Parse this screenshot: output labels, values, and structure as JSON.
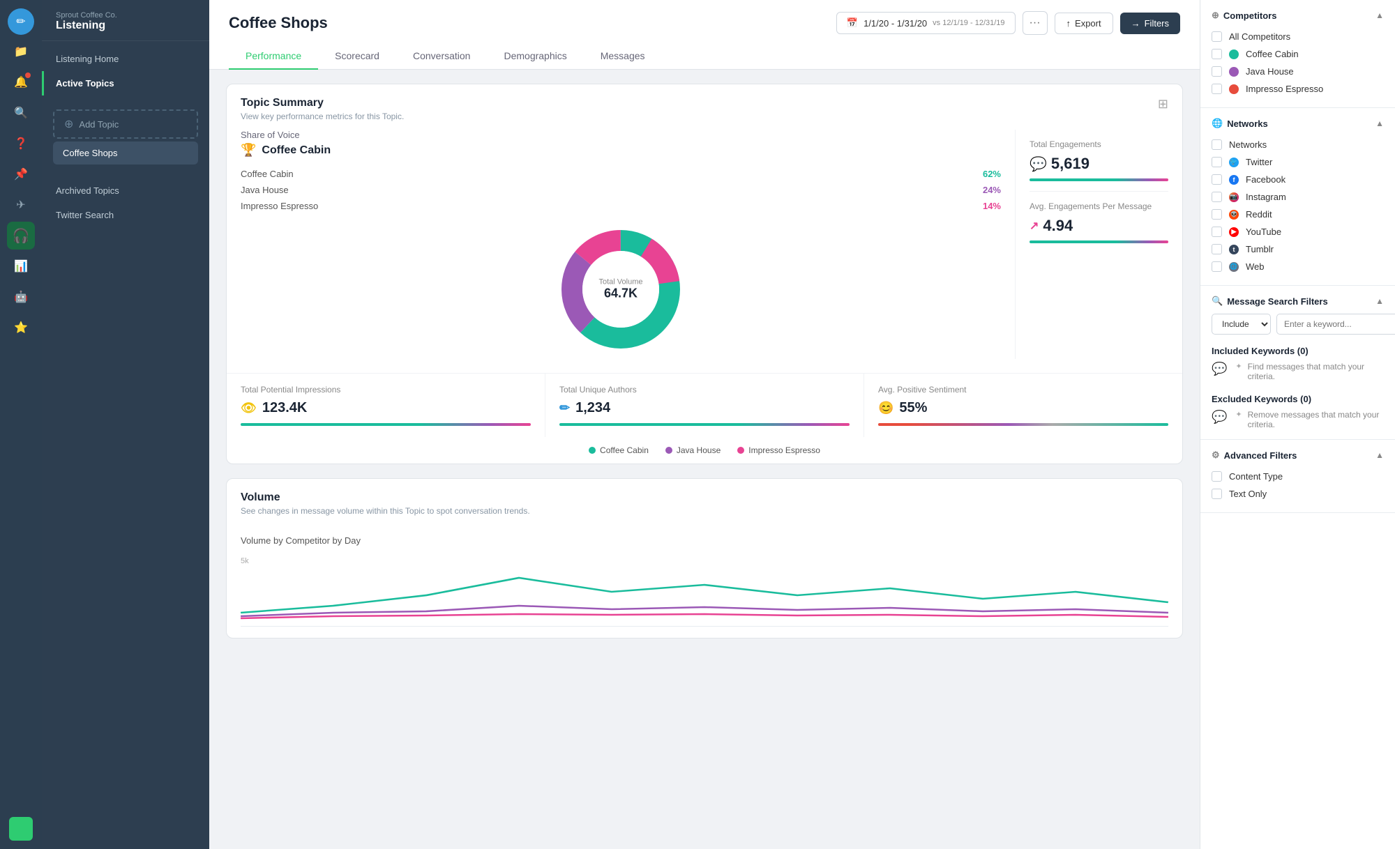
{
  "brand": {
    "company": "Sprout Coffee Co.",
    "product": "Listening"
  },
  "sidebar": {
    "nav_items": [
      {
        "id": "listening-home",
        "label": "Listening Home",
        "active": false
      },
      {
        "id": "active-topics",
        "label": "Active Topics",
        "active": true
      }
    ],
    "add_topic_label": "Add Topic",
    "topics": [
      {
        "id": "coffee-shops",
        "label": "Coffee Shops",
        "active": true
      }
    ],
    "bottom_nav": [
      {
        "id": "archived-topics",
        "label": "Archived Topics"
      },
      {
        "id": "twitter-search",
        "label": "Twitter Search"
      }
    ]
  },
  "header": {
    "page_title": "Coffee Shops",
    "date_range": "1/1/20 - 1/31/20",
    "date_compare": "vs 12/1/19 - 12/31/19",
    "export_label": "Export",
    "filters_label": "Filters"
  },
  "tabs": [
    {
      "id": "performance",
      "label": "Performance",
      "active": true
    },
    {
      "id": "scorecard",
      "label": "Scorecard",
      "active": false
    },
    {
      "id": "conversation",
      "label": "Conversation",
      "active": false
    },
    {
      "id": "demographics",
      "label": "Demographics",
      "active": false
    },
    {
      "id": "messages",
      "label": "Messages",
      "active": false
    }
  ],
  "topic_summary": {
    "title": "Topic Summary",
    "subtitle": "View key performance metrics for this Topic.",
    "share_of_voice_label": "Share of Voice",
    "winner": "Coffee Cabin",
    "competitors": [
      {
        "name": "Coffee Cabin",
        "pct": "62%",
        "color": "teal",
        "donut_pct": 62
      },
      {
        "name": "Java House",
        "pct": "24%",
        "color": "purple",
        "donut_pct": 24
      },
      {
        "name": "Impresso Espresso",
        "pct": "14%",
        "color": "pink",
        "donut_pct": 14
      }
    ],
    "donut_center_label": "Total Volume",
    "donut_center_value": "64.7K",
    "total_engagements_label": "Total Engagements",
    "total_engagements_value": "5,619",
    "avg_engagements_label": "Avg. Engagements Per Message",
    "avg_engagements_value": "4.94",
    "total_impressions_label": "Total Potential Impressions",
    "total_impressions_value": "123.4K",
    "total_authors_label": "Total Unique Authors",
    "total_authors_value": "1,234",
    "avg_sentiment_label": "Avg. Positive Sentiment",
    "avg_sentiment_value": "55%"
  },
  "legend": [
    {
      "label": "Coffee Cabin",
      "color": "#1abc9c"
    },
    {
      "label": "Java House",
      "color": "#9b59b6"
    },
    {
      "label": "Impresso Espresso",
      "color": "#e84393"
    }
  ],
  "volume": {
    "title": "Volume",
    "subtitle": "See changes in message volume within this Topic to spot conversation trends.",
    "chart_label": "Volume by Competitor by Day",
    "y_axis_label": "5k"
  },
  "right_panel": {
    "competitors_title": "Competitors",
    "all_competitors_label": "All Competitors",
    "competitors_list": [
      {
        "id": "coffee-cabin",
        "label": "Coffee Cabin",
        "color": "teal"
      },
      {
        "id": "java-house",
        "label": "Java House",
        "color": "purple"
      },
      {
        "id": "impresso-espresso",
        "label": "Impresso Espresso",
        "color": "pink"
      }
    ],
    "networks_title": "Networks",
    "networks_label": "Networks",
    "networks_list": [
      {
        "id": "twitter",
        "label": "Twitter",
        "color": "twitter"
      },
      {
        "id": "facebook",
        "label": "Facebook",
        "color": "fb"
      },
      {
        "id": "instagram",
        "label": "Instagram",
        "color": "ig"
      },
      {
        "id": "reddit",
        "label": "Reddit",
        "color": "reddit"
      },
      {
        "id": "youtube",
        "label": "YouTube",
        "color": "yt"
      },
      {
        "id": "tumblr",
        "label": "Tumblr",
        "color": "tumblr"
      },
      {
        "id": "web",
        "label": "Web",
        "color": "web"
      }
    ],
    "message_search_title": "Message Search Filters",
    "filter_dropdown_default": "Include",
    "filter_input_placeholder": "Enter a keyword...",
    "included_keywords_title": "Included Keywords (0)",
    "included_keywords_hint": "Find messages that match your criteria.",
    "excluded_keywords_title": "Excluded Keywords (0)",
    "excluded_keywords_hint": "Remove messages that match your criteria.",
    "advanced_filters_title": "Advanced Filters",
    "content_type_label": "Content Type",
    "text_only_label": "Text Only"
  }
}
